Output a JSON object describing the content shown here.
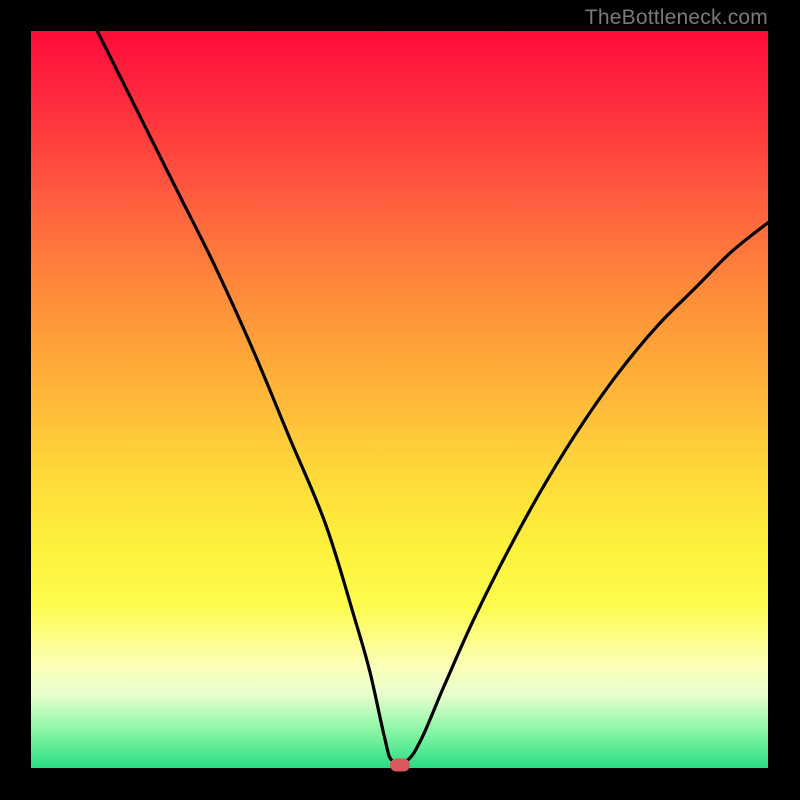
{
  "watermark": "TheBottleneck.com",
  "marker": {
    "color": "#d85a5e"
  },
  "chart_data": {
    "type": "line",
    "title": "",
    "xlabel": "",
    "ylabel": "",
    "xlim": [
      0,
      100
    ],
    "ylim": [
      0,
      100
    ],
    "grid": false,
    "legend": false,
    "annotations": [
      {
        "kind": "marker",
        "x": 50,
        "y": 0,
        "color": "#d85a5e"
      }
    ],
    "series": [
      {
        "name": "curve",
        "x": [
          9,
          15,
          20,
          25,
          30,
          35,
          40,
          44,
          46,
          48,
          49,
          51,
          53,
          56,
          60,
          65,
          70,
          75,
          80,
          85,
          90,
          95,
          100
        ],
        "values": [
          100,
          88,
          78,
          68,
          57,
          45,
          33,
          20,
          13,
          4,
          1,
          1,
          4,
          11,
          20,
          30,
          39,
          47,
          54,
          60,
          65,
          70,
          74
        ]
      }
    ],
    "background_gradient_stops": [
      {
        "pos": 0.0,
        "color": "#ff0b3a"
      },
      {
        "pos": 0.5,
        "color": "#ffd93a"
      },
      {
        "pos": 0.78,
        "color": "#fdfc4e"
      },
      {
        "pos": 1.0,
        "color": "#27dd84"
      }
    ]
  }
}
